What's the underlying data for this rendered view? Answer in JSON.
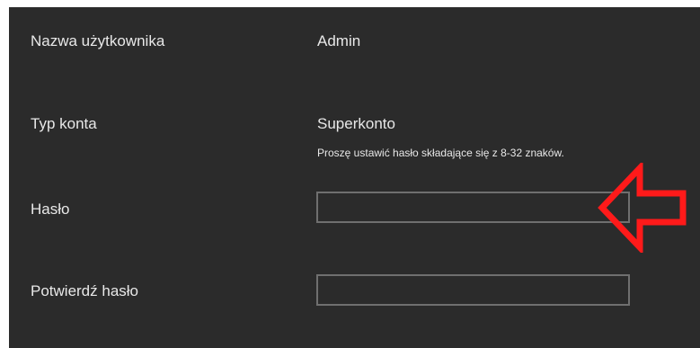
{
  "account_form": {
    "username": {
      "label": "Nazwa użytkownika",
      "value": "Admin"
    },
    "account_type": {
      "label": "Typ konta",
      "value": "Superkonto",
      "password_hint": "Proszę ustawić hasło składające się z 8-32 znaków."
    },
    "password": {
      "label": "Hasło",
      "value": ""
    },
    "confirm_password": {
      "label": "Potwierdź hasło",
      "value": ""
    }
  },
  "annotation": {
    "arrow_icon": "red-outline-arrow-left-icon",
    "arrow_color": "#ff1a1a"
  },
  "colors": {
    "panel_background": "#2b2b2b",
    "text": "#e8e8e8",
    "field_border": "#6f6f6f"
  }
}
